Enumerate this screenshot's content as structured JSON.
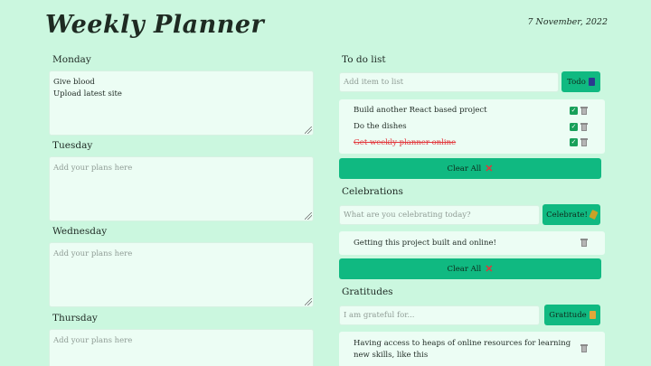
{
  "header": {
    "title": "Weekly Planner",
    "date": "7 November, 2022"
  },
  "days": [
    {
      "label": "Monday",
      "lines": [
        "Give blood",
        "Upload latest site"
      ],
      "placeholder": ""
    },
    {
      "label": "Tuesday",
      "lines": [],
      "placeholder": "Add your plans here"
    },
    {
      "label": "Wednesday",
      "lines": [],
      "placeholder": "Add your plans here"
    },
    {
      "label": "Thursday",
      "lines": [],
      "placeholder": "Add your plans here"
    }
  ],
  "todo": {
    "label": "To do list",
    "placeholder": "Add item to list",
    "button": "Todo",
    "button_icon": "clipboard-icon",
    "items": [
      {
        "text": "Build another React based project",
        "done": false
      },
      {
        "text": "Do the dishes",
        "done": false
      },
      {
        "text": "Get weekly planner online",
        "done": true
      }
    ],
    "clear_label": "Clear All"
  },
  "celebrations": {
    "label": "Celebrations",
    "placeholder": "What are you celebrating today?",
    "button": "Celebrate!",
    "button_icon": "party-popper-icon",
    "items": [
      {
        "text": "Getting this project built and online!"
      }
    ],
    "clear_label": "Clear All"
  },
  "gratitudes": {
    "label": "Gratitudes",
    "placeholder": "I am grateful for...",
    "button": "Gratitude",
    "button_icon": "praying-hands-icon",
    "items": [
      {
        "text": "Having access to heaps of online resources for learning new skills, like this"
      }
    ]
  },
  "colors": {
    "background": "#cbf7df",
    "card": "#ecfdf4",
    "accent": "#10b981",
    "done": "#e2363b"
  }
}
